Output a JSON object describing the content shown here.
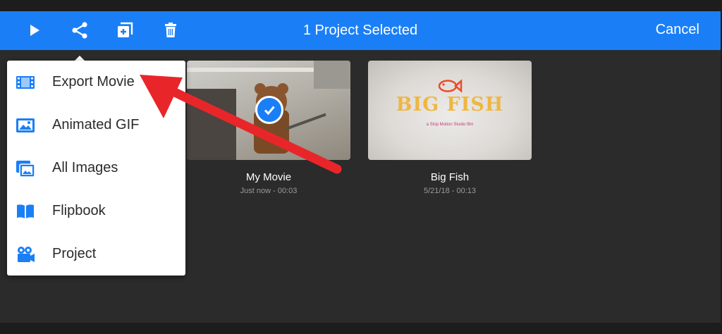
{
  "colors": {
    "accent": "#1a7ff7",
    "background": "#2b2b2b",
    "arrow": "#e8262a"
  },
  "toolbar": {
    "play_icon": "play-icon",
    "share_icon": "share-icon",
    "duplicate_icon": "duplicate-icon",
    "delete_icon": "trash-icon",
    "title": "1 Project Selected",
    "cancel_label": "Cancel"
  },
  "share_menu": {
    "items": [
      {
        "label": "Export Movie",
        "icon": "film-icon"
      },
      {
        "label": "Animated GIF",
        "icon": "image-icon"
      },
      {
        "label": "All Images",
        "icon": "images-icon"
      },
      {
        "label": "Flipbook",
        "icon": "book-icon"
      },
      {
        "label": "Project",
        "icon": "camera-icon"
      }
    ]
  },
  "projects": [
    {
      "name": "My Movie",
      "meta": "Just now - 00:03",
      "selected": true
    },
    {
      "name": "Big Fish",
      "meta": "5/21/18 - 00:13",
      "selected": false,
      "thumb_title": "BIG FISH",
      "thumb_subtitle": "a Stop Motion Studio film"
    }
  ]
}
